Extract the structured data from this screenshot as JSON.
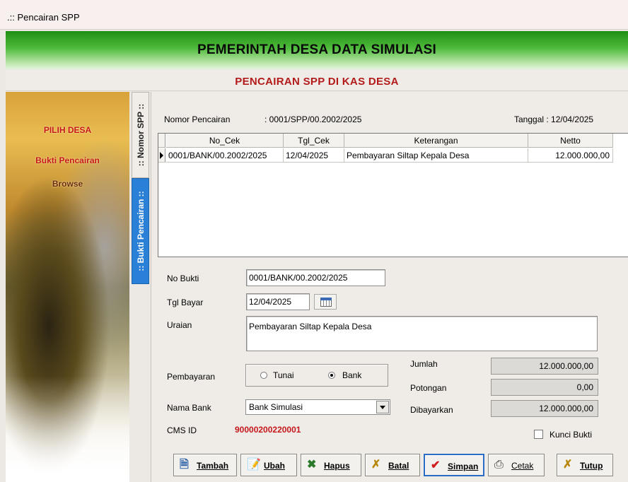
{
  "window": {
    "title": ".:: Pencairan SPP"
  },
  "banner": {
    "title": "PEMERINTAH DESA DATA SIMULASI"
  },
  "subheader": {
    "title": "PENCAIRAN SPP DI KAS DESA"
  },
  "sidebar": {
    "items": [
      {
        "label": "PILIH DESA"
      },
      {
        "label": "Bukti Pencairan"
      },
      {
        "label": "Browse"
      }
    ]
  },
  "tabs": [
    {
      "label": ":: Nomor SPP ::",
      "active": false
    },
    {
      "label": ":: Bukti Pencairan ::",
      "active": true
    }
  ],
  "header": {
    "nomor_label": "Nomor Pencairan",
    "nomor_value": ": 0001/SPP/00.2002/2025",
    "tanggal": "Tanggal : 12/04/2025"
  },
  "grid": {
    "columns": [
      "No_Cek",
      "Tgl_Cek",
      "Keterangan",
      "Netto"
    ],
    "rows": [
      [
        "0001/BANK/00.2002/2025",
        "12/04/2025",
        "Pembayaran Siltap Kepala Desa",
        "12.000.000,00"
      ]
    ]
  },
  "form": {
    "no_bukti_label": "No Bukti",
    "no_bukti_value": "0001/BANK/00.2002/2025",
    "tgl_bayar_label": "Tgl Bayar",
    "tgl_bayar_value": "12/04/2025",
    "uraian_label": "Uraian",
    "uraian_value": "Pembayaran Siltap Kepala Desa",
    "pembayaran_label": "Pembayaran",
    "radio_tunai": "Tunai",
    "radio_bank": "Bank",
    "selected_payment": "Bank",
    "nama_bank_label": "Nama Bank",
    "nama_bank_value": "Bank Simulasi",
    "cms_label": "CMS ID",
    "cms_value": "90000200220001",
    "jumlah_label": "Jumlah",
    "jumlah_value": "12.000.000,00",
    "potongan_label": "Potongan",
    "potongan_value": "0,00",
    "dibayarkan_label": "Dibayarkan",
    "dibayarkan_value": "12.000.000,00",
    "kunci_label": "Kunci Bukti",
    "kunci_checked": false
  },
  "buttons": [
    {
      "label": "Tambah",
      "icon": "add-document-icon"
    },
    {
      "label": "Ubah",
      "icon": "edit-document-icon"
    },
    {
      "label": "Hapus",
      "icon": "delete-icon"
    },
    {
      "label": "Batal",
      "icon": "cancel-icon"
    },
    {
      "label": "Simpan",
      "icon": "checkmark-icon"
    },
    {
      "label": "Cetak",
      "icon": "printer-icon"
    },
    {
      "label": "Tutup",
      "icon": "close-icon"
    }
  ],
  "colors": {
    "accent_red": "#c5171b",
    "tab_active": "#2a7fd6",
    "banner_green": "#2f9a21"
  }
}
